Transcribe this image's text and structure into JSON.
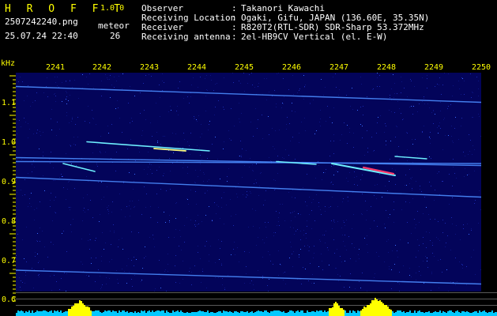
{
  "header": {
    "brand": "H R O F F T",
    "version": "1.0.0",
    "filename": "2507242240.png",
    "timestamp": "25.07.24 22:40",
    "mode_label": "meteor",
    "count": "26",
    "info": [
      {
        "label": "Observer",
        "sep": ":",
        "value": "Takanori Kawachi"
      },
      {
        "label": "Receiving Location",
        "sep": ":",
        "value": "Ogaki, Gifu, JAPAN (136.60E, 35.35N)"
      },
      {
        "label": "Receiver",
        "sep": ":",
        "value": "R820T2(RTL-SDR) SDR-Sharp 53.372MHz"
      },
      {
        "label": "Receiving antenna",
        "sep": ":",
        "value": "2el-HB9CV Vertical (el. E-W)"
      }
    ]
  },
  "axis": {
    "y_unit": "kHz",
    "x_ticks": [
      "2241",
      "2242",
      "2243",
      "2244",
      "2245",
      "2246",
      "2247",
      "2248",
      "2249",
      "2250"
    ],
    "y_ticks": [
      "1.1",
      "1.0",
      "0.9",
      "0.8",
      "0.7",
      "0.6"
    ]
  },
  "colors": {
    "background": "#000000",
    "spectrogram_bg": "#03045a",
    "label_yellow": "#ffff00",
    "text_white": "#ffffff",
    "trace_blue": "#4a8cff",
    "trace_cyan": "#6ef0ff",
    "meteor_red": "#ff3b6b",
    "bottom_cyan": "#00c8ff",
    "bottom_yellow": "#ffff00"
  },
  "chart_data": {
    "type": "heatmap",
    "y_unit": "kHz",
    "x_ticks_minutes": [
      "2241",
      "2242",
      "2243",
      "2244",
      "2245",
      "2246",
      "2247",
      "2248",
      "2249",
      "2250"
    ],
    "y_ticks_khz": [
      1.1,
      1.0,
      0.9,
      0.8,
      0.7,
      0.6
    ],
    "traces": [
      {
        "start_khz": 1.145,
        "end_khz": 1.105,
        "kind": "carrier"
      },
      {
        "start_khz": 0.965,
        "end_khz": 0.945,
        "kind": "carrier"
      },
      {
        "start_khz": 0.955,
        "end_khz": 0.95,
        "kind": "carrier"
      },
      {
        "start_khz": 0.915,
        "end_khz": 0.865,
        "kind": "carrier"
      },
      {
        "start_khz": 0.68,
        "end_khz": 0.645,
        "kind": "carrier"
      }
    ]
  }
}
